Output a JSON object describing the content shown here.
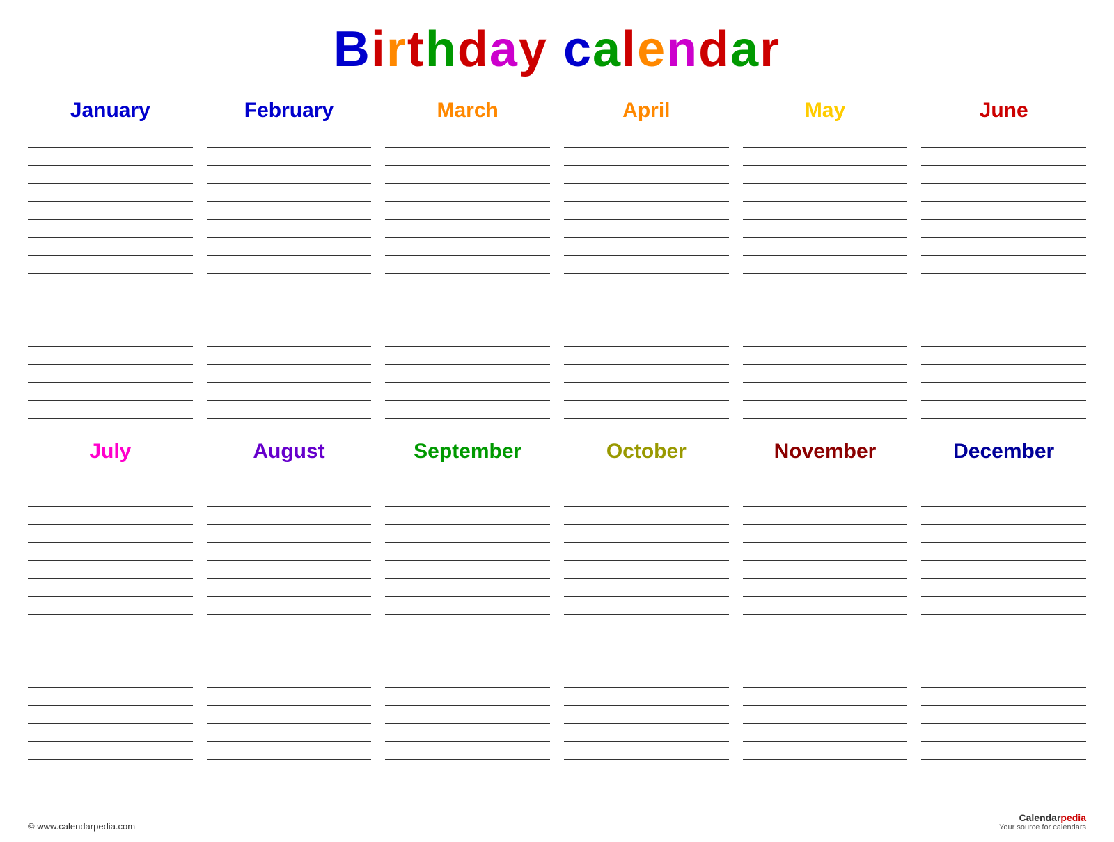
{
  "title": {
    "full": "Birthday calendar",
    "letters": [
      {
        "char": "B",
        "color": "#0000cc"
      },
      {
        "char": "i",
        "color": "#cc0000"
      },
      {
        "char": "r",
        "color": "#ff8800"
      },
      {
        "char": "t",
        "color": "#cc0000"
      },
      {
        "char": "h",
        "color": "#009900"
      },
      {
        "char": "d",
        "color": "#cc0000"
      },
      {
        "char": "a",
        "color": "#cc00cc"
      },
      {
        "char": "y",
        "color": "#cc0000"
      },
      {
        "char": " ",
        "color": "#000"
      },
      {
        "char": "c",
        "color": "#0000cc"
      },
      {
        "char": "a",
        "color": "#009900"
      },
      {
        "char": "l",
        "color": "#cc0000"
      },
      {
        "char": "e",
        "color": "#ff8800"
      },
      {
        "char": "n",
        "color": "#cc00cc"
      },
      {
        "char": "d",
        "color": "#cc0000"
      },
      {
        "char": "a",
        "color": "#009900"
      },
      {
        "char": "r",
        "color": "#cc0000"
      }
    ]
  },
  "top_months": [
    {
      "label": "January",
      "color": "#0000cc",
      "lines": 16
    },
    {
      "label": "February",
      "color": "#0000cc",
      "lines": 16
    },
    {
      "label": "March",
      "color": "#ff8800",
      "lines": 16
    },
    {
      "label": "April",
      "color": "#ff8800",
      "lines": 16
    },
    {
      "label": "May",
      "color": "#ffcc00",
      "lines": 16
    },
    {
      "label": "June",
      "color": "#cc0000",
      "lines": 16
    }
  ],
  "bottom_months": [
    {
      "label": "July",
      "color": "#ff00cc",
      "lines": 16
    },
    {
      "label": "August",
      "color": "#6600cc",
      "lines": 16
    },
    {
      "label": "September",
      "color": "#009900",
      "lines": 16
    },
    {
      "label": "October",
      "color": "#999900",
      "lines": 16
    },
    {
      "label": "November",
      "color": "#8B0000",
      "lines": 16
    },
    {
      "label": "December",
      "color": "#000099",
      "lines": 16
    }
  ],
  "footer": {
    "left": "© www.calendarpedia.com",
    "right_prefix": "Calendar",
    "right_suffix": "pedia",
    "right_sub": "Your source for calendars"
  }
}
